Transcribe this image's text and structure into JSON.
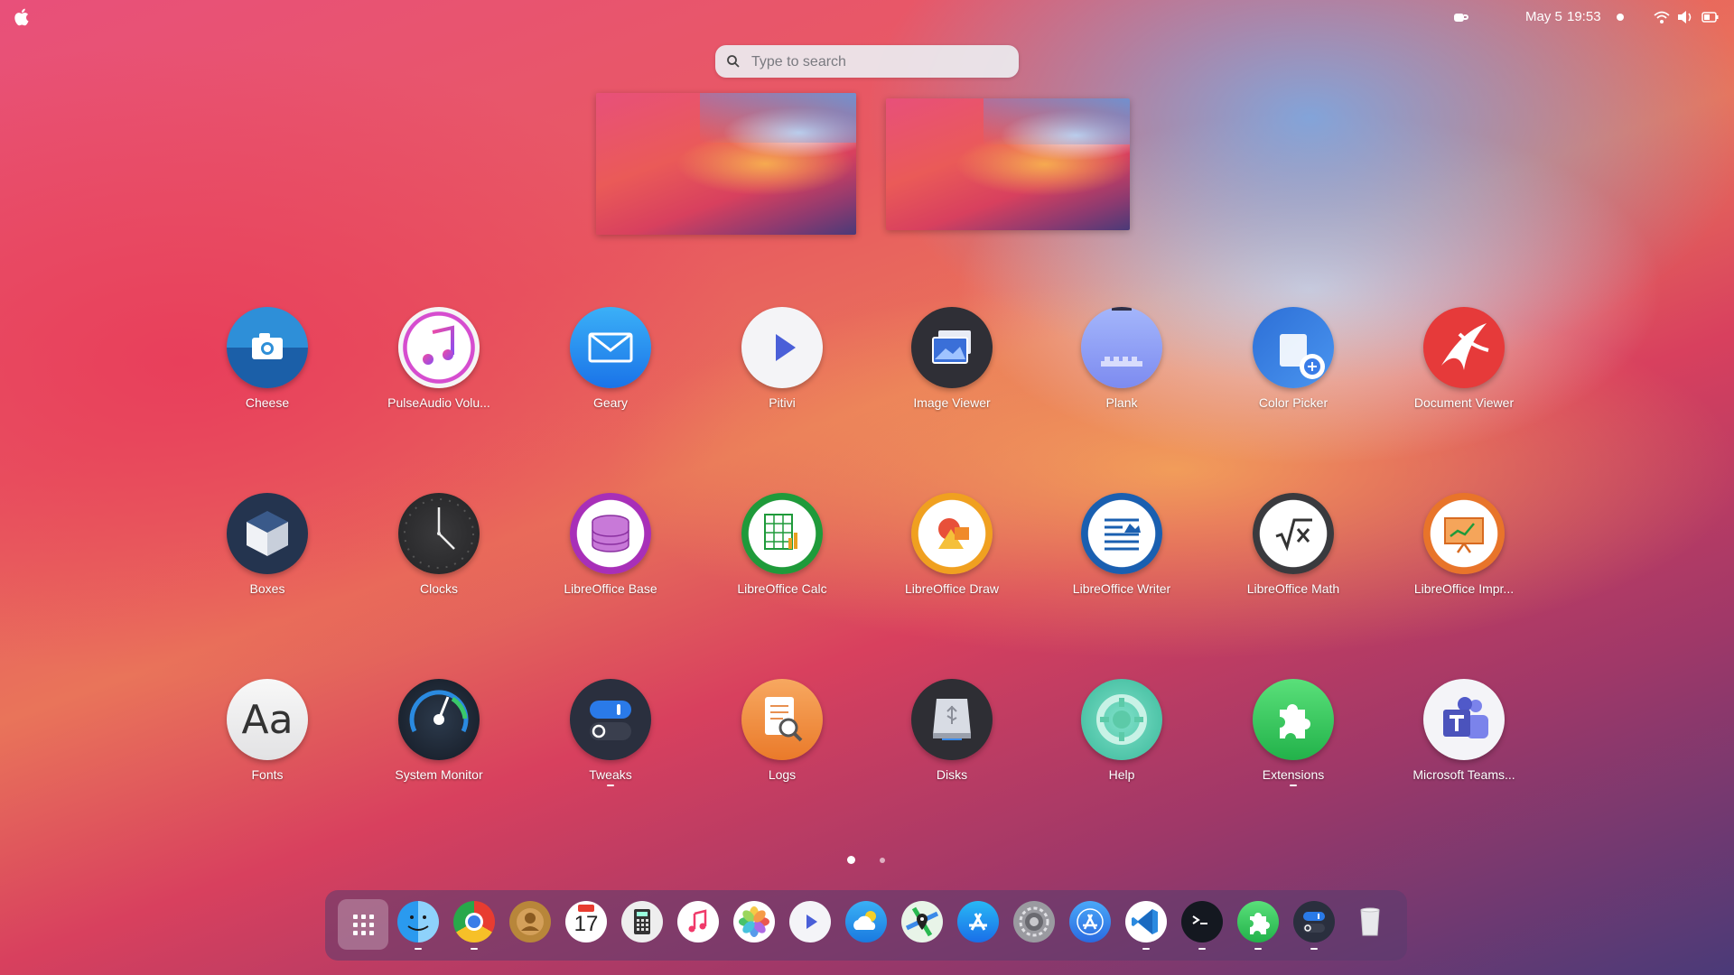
{
  "topbar": {
    "date": "May 5",
    "time": "19:53",
    "icons": [
      "apple-icon",
      "coffee-icon",
      "status-dot-icon",
      "wifi-icon",
      "volume-icon",
      "battery-icon"
    ]
  },
  "search": {
    "placeholder": "Type to search"
  },
  "apps": [
    {
      "label": "Cheese",
      "icon": "camera-icon"
    },
    {
      "label": "PulseAudio Volu...",
      "icon": "music-note-icon"
    },
    {
      "label": "Geary",
      "icon": "mail-icon"
    },
    {
      "label": "Pitivi",
      "icon": "play-icon"
    },
    {
      "label": "Image Viewer",
      "icon": "image-viewer-icon"
    },
    {
      "label": "Plank",
      "icon": "plank-icon"
    },
    {
      "label": "Color Picker",
      "icon": "color-picker-icon"
    },
    {
      "label": "Document Viewer",
      "icon": "document-viewer-icon"
    },
    {
      "label": "Boxes",
      "icon": "boxes-icon"
    },
    {
      "label": "Clocks",
      "icon": "clock-icon"
    },
    {
      "label": "LibreOffice Base",
      "icon": "database-icon"
    },
    {
      "label": "LibreOffice Calc",
      "icon": "spreadsheet-icon"
    },
    {
      "label": "LibreOffice Draw",
      "icon": "draw-icon"
    },
    {
      "label": "LibreOffice Writer",
      "icon": "writer-icon"
    },
    {
      "label": "LibreOffice Math",
      "icon": "math-icon"
    },
    {
      "label": "LibreOffice Impr...",
      "icon": "impress-icon"
    },
    {
      "label": "Fonts",
      "icon": "fonts-icon"
    },
    {
      "label": "System Monitor",
      "icon": "gauge-icon"
    },
    {
      "label": "Tweaks",
      "icon": "toggle-icon",
      "running": true
    },
    {
      "label": "Logs",
      "icon": "logs-icon"
    },
    {
      "label": "Disks",
      "icon": "disk-icon"
    },
    {
      "label": "Help",
      "icon": "lifebuoy-icon"
    },
    {
      "label": "Extensions",
      "icon": "puzzle-icon",
      "running": true
    },
    {
      "label": "Microsoft Teams...",
      "icon": "teams-icon"
    }
  ],
  "fonts_icon_text": "Aa",
  "calendar_day": "17",
  "pages": {
    "count": 2,
    "active": 1
  },
  "dock": [
    "app-grid-icon",
    "finder-icon",
    "chrome-icon",
    "contacts-icon",
    "calendar-icon",
    "calculator-icon",
    "music-icon",
    "photos-icon",
    "video-player-icon",
    "weather-icon",
    "maps-icon",
    "app-store-icon",
    "settings-icon",
    "app-store-alt-icon",
    "vscode-icon",
    "terminal-icon",
    "extensions-icon",
    "tweaks-icon",
    "trash-icon"
  ]
}
